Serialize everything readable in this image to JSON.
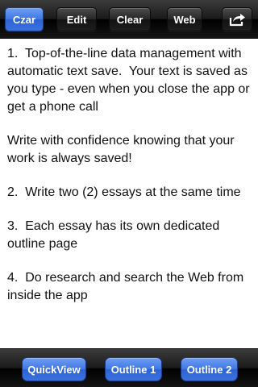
{
  "toolbar": {
    "czar_label": "Czar",
    "edit_label": "Edit",
    "clear_label": "Clear",
    "web_label": "Web",
    "share_icon": "share-icon",
    "active_color": "#3e77e6"
  },
  "content": {
    "paragraphs": [
      "1.  Top-of-the-line data management with automatic text save.  Your text is saved as you type - even when you close the app or get a phone call",
      "Write with confidence knowing that your work is always saved!",
      "2.  Write two (2) essays at the same time",
      "3.  Each essay has its own dedicated outline page",
      "4.  Do research and search the Web from inside the app"
    ]
  },
  "bottombar": {
    "quickview_label": "QuickView",
    "outline1_label": "Outline 1",
    "outline2_label": "Outline 2"
  }
}
